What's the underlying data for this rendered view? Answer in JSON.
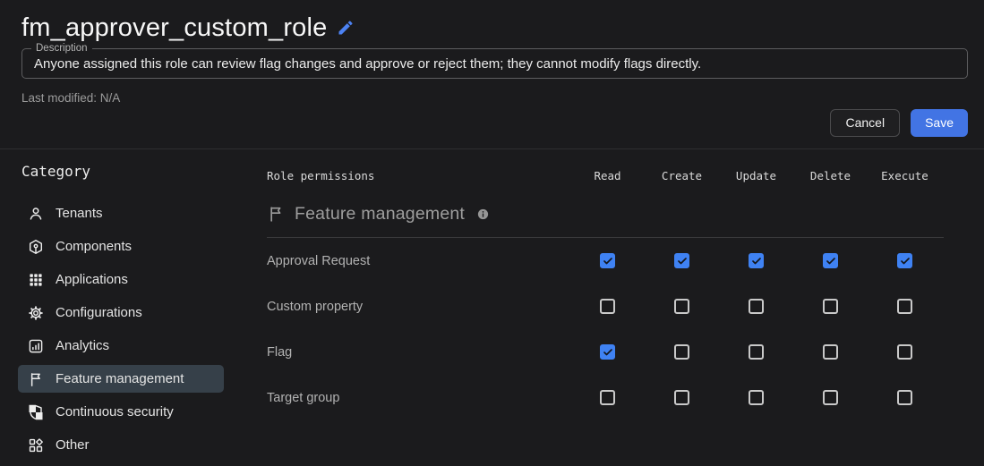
{
  "header": {
    "title": "fm_approver_custom_role",
    "edit_icon": "pencil-icon",
    "description_label": "Description",
    "description_value": "Anyone assigned this role can review flag changes and approve or reject them; they cannot modify flags directly.",
    "last_modified": "Last modified: N/A",
    "cancel_label": "Cancel",
    "save_label": "Save"
  },
  "ui_colors": {
    "accent_blue": "#4274e4",
    "checkbox_blue": "#3f82f3",
    "selected_item_bg": "#364049",
    "edit_pencil_blue": "#4c82f3"
  },
  "sidebar": {
    "heading": "Category",
    "items": [
      {
        "label": "Tenants",
        "icon": "person-icon",
        "selected": false
      },
      {
        "label": "Components",
        "icon": "component-icon",
        "selected": false
      },
      {
        "label": "Applications",
        "icon": "apps-grid-icon",
        "selected": false
      },
      {
        "label": "Configurations",
        "icon": "gear-icon",
        "selected": false
      },
      {
        "label": "Analytics",
        "icon": "analytics-icon",
        "selected": false
      },
      {
        "label": "Feature management",
        "icon": "flag-icon",
        "selected": true
      },
      {
        "label": "Continuous security",
        "icon": "shield-icon",
        "selected": false
      },
      {
        "label": "Other",
        "icon": "other-grid-icon",
        "selected": false
      }
    ]
  },
  "permissions": {
    "table_label": "Role permissions",
    "columns": [
      "Read",
      "Create",
      "Update",
      "Delete",
      "Execute"
    ],
    "section": {
      "icon": "flag-icon",
      "title": "Feature management",
      "info_icon": "info-icon"
    },
    "rows": [
      {
        "label": "Approval Request",
        "checks": [
          true,
          true,
          true,
          true,
          true
        ]
      },
      {
        "label": "Custom property",
        "checks": [
          false,
          false,
          false,
          false,
          false
        ]
      },
      {
        "label": "Flag",
        "checks": [
          true,
          false,
          false,
          false,
          false
        ]
      },
      {
        "label": "Target group",
        "checks": [
          false,
          false,
          false,
          false,
          false
        ]
      }
    ]
  }
}
